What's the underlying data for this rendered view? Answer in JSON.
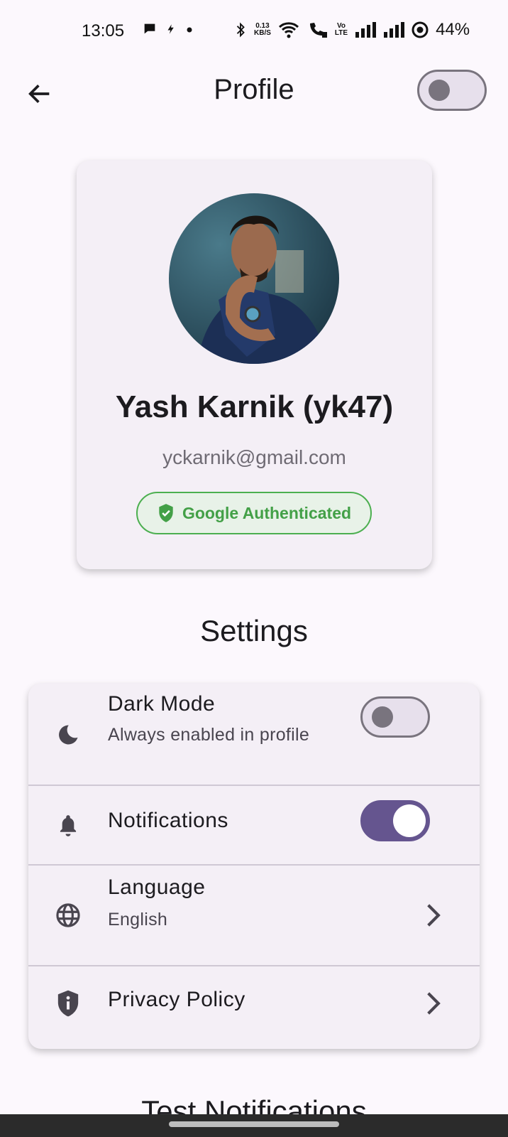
{
  "status_bar": {
    "time": "13:05",
    "speed_value": "0.13",
    "speed_unit": "KB/S",
    "volte_top": "Vo",
    "volte_bottom": "LTE",
    "battery": "44%"
  },
  "app_bar": {
    "title": "Profile",
    "theme_switch_on": false
  },
  "profile": {
    "name": "Yash Karnik (yk47)",
    "email": "yckarnik@gmail.com",
    "badge": "Google Authenticated"
  },
  "settings": {
    "section_title": "Settings",
    "items": [
      {
        "title": "Dark Mode",
        "subtitle": "Always enabled in profile",
        "icon": "moon-icon",
        "control": "switch",
        "on": false
      },
      {
        "title": "Notifications",
        "subtitle": "",
        "icon": "bell-icon",
        "control": "switch",
        "on": true
      },
      {
        "title": "Language",
        "subtitle": "English",
        "icon": "globe-icon",
        "control": "chevron"
      },
      {
        "title": "Privacy Policy",
        "subtitle": "",
        "icon": "shield-info-icon",
        "control": "chevron"
      }
    ]
  },
  "next_section_title": "Test Notifications",
  "colors": {
    "background": "#fcf8fd",
    "card": "#f4eff6",
    "accent": "#65558f",
    "success": "#43a047"
  }
}
